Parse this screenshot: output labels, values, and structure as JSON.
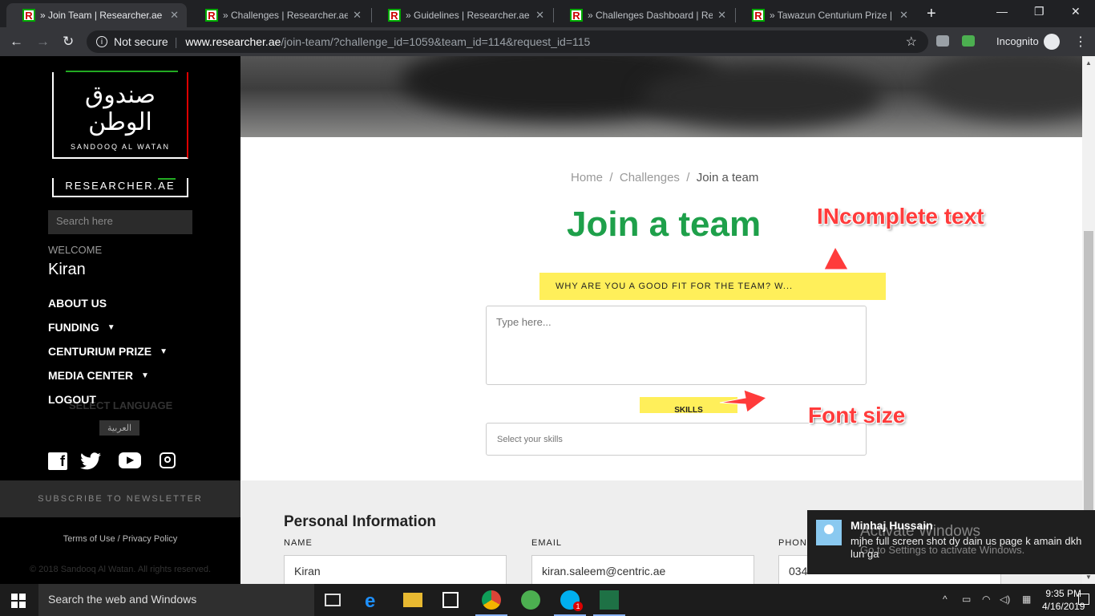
{
  "browser": {
    "tabs": [
      {
        "label": "» Join Team | Researcher.ae",
        "active": true
      },
      {
        "label": "» Challenges | Researcher.ae",
        "active": false
      },
      {
        "label": "» Guidelines | Researcher.ae",
        "active": false
      },
      {
        "label": "» Challenges Dashboard | Rese",
        "active": false
      },
      {
        "label": "» Tawazun Centurium Prize | Re",
        "active": false
      }
    ],
    "favicon_letter": "R",
    "security_label": "Not secure",
    "url_host": "www.researcher.ae",
    "url_path": "/join-team/?challenge_id=1059&team_id=114&request_id=115",
    "incognito_label": "Incognito"
  },
  "sidebar": {
    "logo_arabic_line1": "صندوق",
    "logo_arabic_line2": "الوطن",
    "logo_english": "SANDOOQ AL WATAN",
    "researcher_main": "RESEARCHER.",
    "researcher_ae": "AE",
    "search_placeholder": "Search here",
    "welcome_label": "WELCOME",
    "username": "Kiran",
    "nav": [
      {
        "label": "ABOUT US",
        "has_dropdown": false
      },
      {
        "label": "FUNDING",
        "has_dropdown": true
      },
      {
        "label": "CENTURIUM PRIZE",
        "has_dropdown": true
      },
      {
        "label": "MEDIA CENTER",
        "has_dropdown": true
      },
      {
        "label": "LOGOUT",
        "has_dropdown": false
      }
    ],
    "select_language": "SELECT LANGUAGE",
    "language_button": "العربية",
    "social": [
      "facebook-icon",
      "twitter-icon",
      "youtube-icon",
      "instagram-icon"
    ],
    "newsletter": "SUBSCRIBE TO NEWSLETTER",
    "terms": "Terms of Use / Privacy Policy",
    "copyright": "© 2018 Sandooq Al Watan. All rights reserved."
  },
  "main": {
    "breadcrumb": {
      "home": "Home",
      "sep": "/",
      "challenges": "Challenges",
      "current": "Join a team"
    },
    "title": "Join a team",
    "question_label": "WHY ARE YOU A GOOD FIT FOR THE TEAM? W...",
    "textarea_placeholder": "Type here...",
    "skills_label": "SKILLS",
    "skills_placeholder": "Select your skills",
    "personal_info_title": "Personal Information",
    "fields": [
      {
        "label": "NAME",
        "value": "Kiran"
      },
      {
        "label": "EMAIL",
        "value": "kiran.saleem@centric.ae"
      },
      {
        "label": "PHON",
        "value": "034"
      }
    ]
  },
  "annotations": {
    "incomplete_text": "INcomplete text",
    "font_size": "Font size",
    "color": "#ff3b3b"
  },
  "toast": {
    "name": "Minhaj Hussain",
    "message": "mjhe full screen shot dy dain us page k amain dkh lun ga"
  },
  "watermark": {
    "line1": "Activate Windows",
    "line2": "Go to Settings to activate Windows."
  },
  "taskbar": {
    "search_placeholder": "Search the web and Windows",
    "time": "9:35 PM",
    "date": "4/16/2019",
    "skype_badge": "1"
  },
  "colors": {
    "accent_green": "#1ea04a",
    "highlight_yellow": "#ffef5a"
  }
}
